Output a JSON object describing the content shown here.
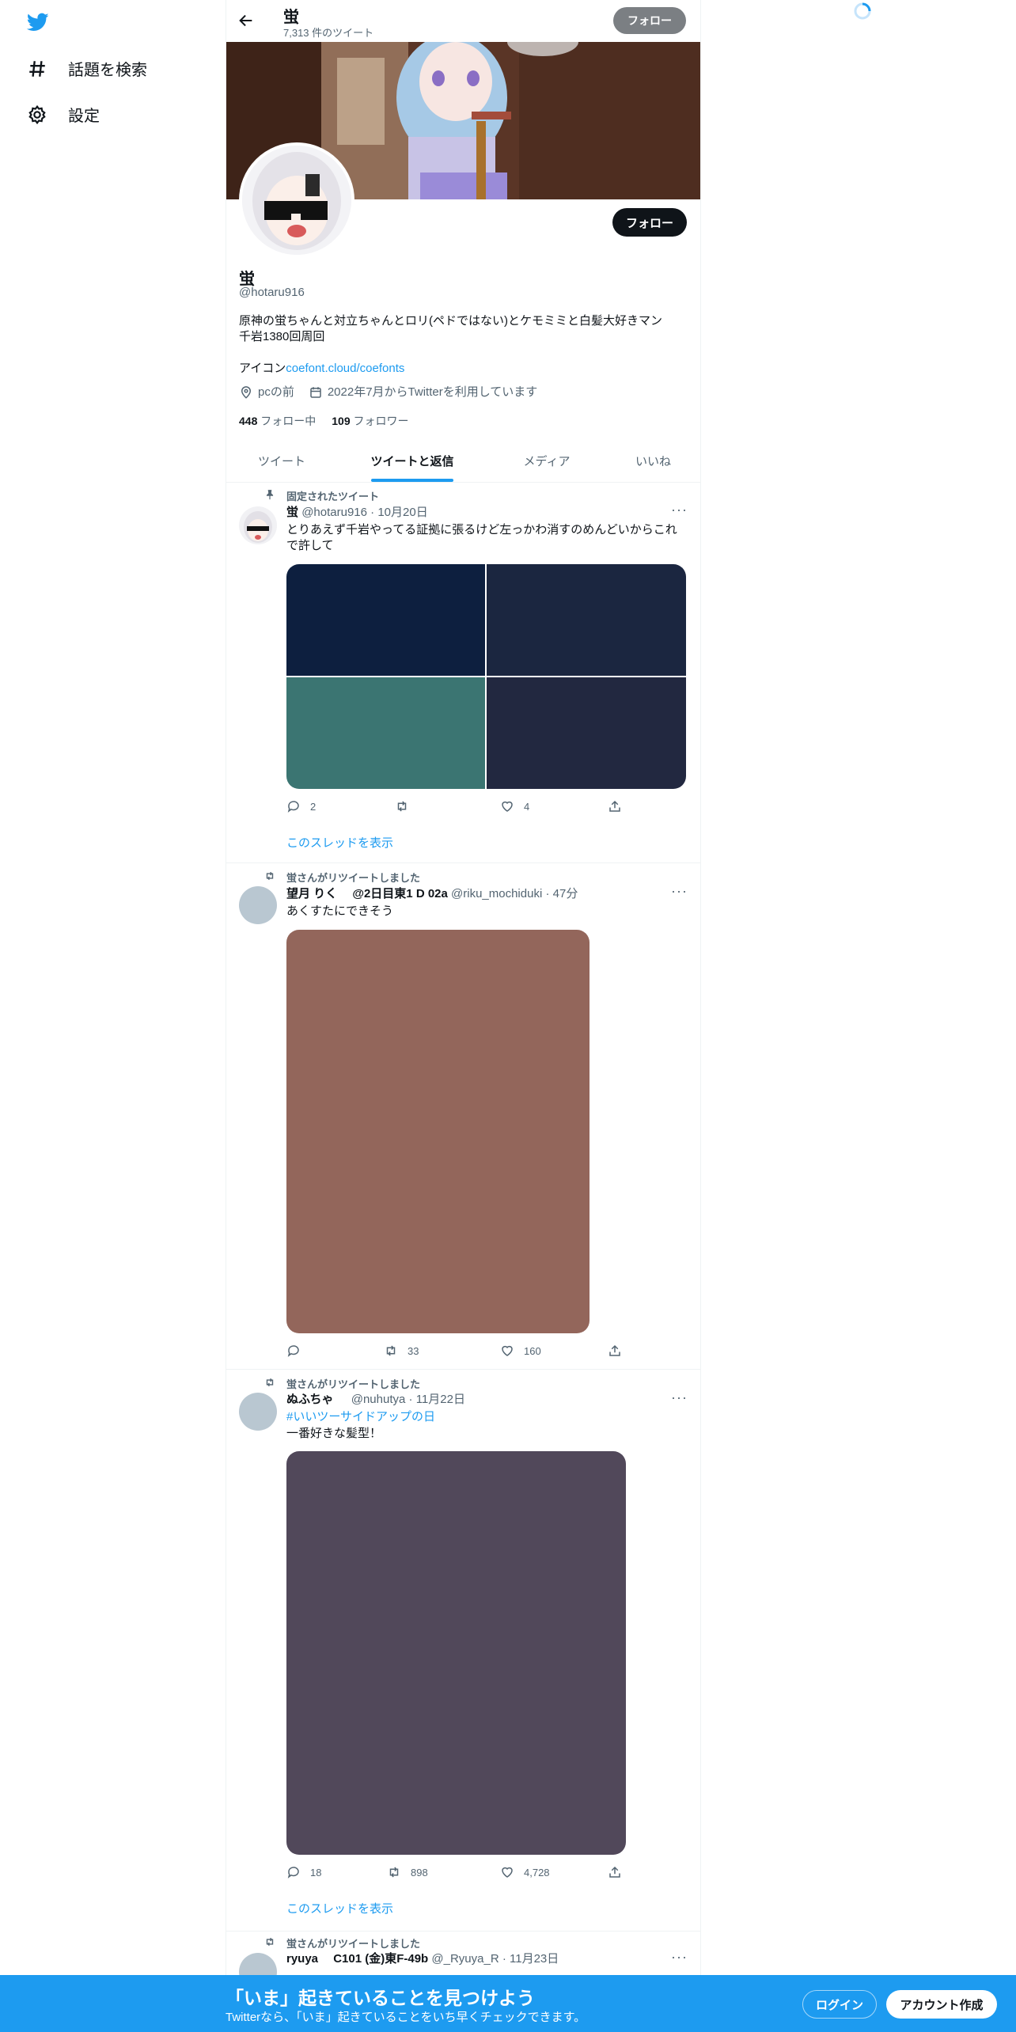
{
  "nav": {
    "explore_label": "話題を検索",
    "settings_label": "設定"
  },
  "header": {
    "name": "蛍",
    "tweet_count": "7,313 件のツイート",
    "follow_label": "フォロー"
  },
  "profile": {
    "follow_label": "フォロー",
    "name": "蛍",
    "handle": "@hotaru916",
    "bio_line1": "原神の蛍ちゃんと対立ちゃんとロリ(ペドではない)とケモミミと白髪大好きマン",
    "bio_line2": "千岩1380回周回",
    "icon_prefix": "アイコン",
    "icon_link": "coefont.cloud/coefonts",
    "location": "pcの前",
    "joined": "2022年7月からTwitterを利用しています",
    "following_count": "448",
    "following_label": "フォロー中",
    "followers_count": "109",
    "followers_label": "フォロワー"
  },
  "tabs": [
    {
      "label": "ツイート"
    },
    {
      "label": "ツイートと返信"
    },
    {
      "label": "メディア"
    },
    {
      "label": "いいね"
    }
  ],
  "tweets": [
    {
      "context": "固定されたツイート",
      "name": "蛍",
      "handle": "@hotaru916",
      "time": "10月20日",
      "text_line1": "とりあえず千岩やってる証拠に張るけど左っかわ消すのめんどいからこれ",
      "text_line2": "で許して",
      "reply_count": "2",
      "retweet_count": "",
      "like_count": "4",
      "thread_link": "このスレッドを表示",
      "media_colors": [
        "#0d1f3f",
        "#1b2640",
        "#3b7572",
        "#222840"
      ]
    },
    {
      "context": "蛍さんがリツイートしました",
      "name": "望月 りく　 @2日目東1 D 02a",
      "handle": "@riku_mochiduki",
      "time": "47分",
      "text_line1": "あくすたにできそう",
      "reply_count": "",
      "retweet_count": "33",
      "like_count": "160",
      "media_color": "#93665b"
    },
    {
      "context": "蛍さんがリツイートしました",
      "name": "ぬふちゃ",
      "handle": "@nuhutya",
      "time": "11月22日",
      "hashtag": "#いいツーサイドアップの日",
      "text_line1": "一番好きな髪型！",
      "reply_count": "18",
      "retweet_count": "898",
      "like_count": "4,728",
      "thread_link": "このスレッドを表示",
      "media_color": "#51485a"
    },
    {
      "context": "蛍さんがリツイートしました",
      "name": "ryuya　 C101 (金)東F-49b",
      "handle": "@_Ryuya_R",
      "time": "11月23日"
    }
  ],
  "bottom_bar": {
    "title": "「いま」起きていることを見つけよう",
    "subtitle": "Twitterなら、「いま」起きていることをいち早くチェックできます。",
    "login_label": "ログイン",
    "signup_label": "アカウント作成"
  },
  "colors": {
    "accent": "#1d9bf0",
    "text": "#0f1419",
    "muted": "#536471"
  }
}
